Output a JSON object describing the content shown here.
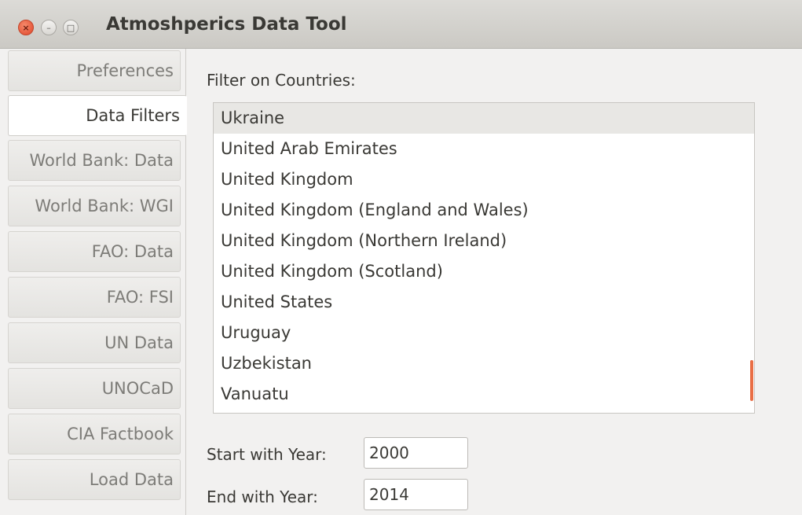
{
  "window": {
    "title": "Atmoshperics Data Tool",
    "close_glyph": "×",
    "minimize_glyph": "–",
    "maximize_glyph": "□"
  },
  "sidebar": {
    "tabs": [
      {
        "label": "Preferences",
        "active": false
      },
      {
        "label": "Data Filters",
        "active": true
      },
      {
        "label": "World Bank: Data",
        "active": false
      },
      {
        "label": "World Bank: WGI",
        "active": false
      },
      {
        "label": "FAO: Data",
        "active": false
      },
      {
        "label": "FAO: FSI",
        "active": false
      },
      {
        "label": "UN Data",
        "active": false
      },
      {
        "label": "UNOCaD",
        "active": false
      },
      {
        "label": "CIA Factbook",
        "active": false
      },
      {
        "label": "Load Data",
        "active": false
      }
    ]
  },
  "filters": {
    "countries_label": "Filter on Countries:",
    "countries": [
      "Ukraine",
      "United Arab Emirates",
      "United Kingdom",
      "United Kingdom (England and Wales)",
      "United Kingdom (Northern Ireland)",
      "United Kingdom (Scotland)",
      "United States",
      "Uruguay",
      "Uzbekistan",
      "Vanuatu"
    ],
    "selected_country": "Ukraine",
    "start_year_label": "Start with Year:",
    "start_year_value": "2000",
    "end_year_label": "End with Year:",
    "end_year_value": "2014"
  },
  "colors": {
    "scrollbar_accent": "#e96e45",
    "close_button": "#e0462a"
  }
}
